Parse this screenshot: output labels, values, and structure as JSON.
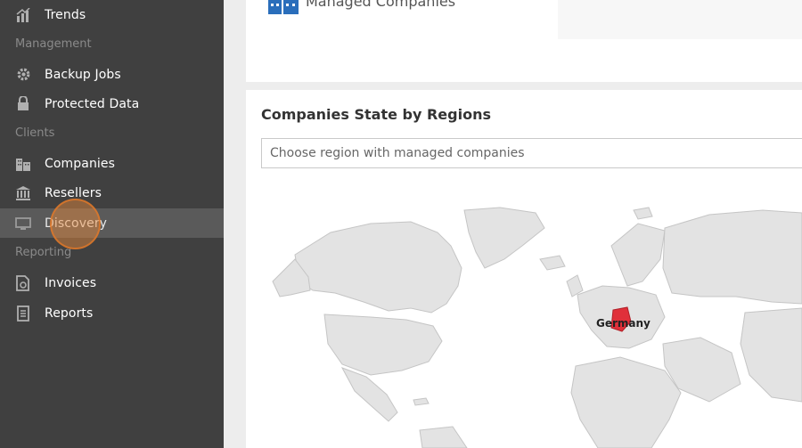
{
  "sidebar": {
    "items": [
      {
        "label": "Trends",
        "icon": "trends-icon"
      },
      {
        "label": "Backup Jobs",
        "icon": "gear-icon"
      },
      {
        "label": "Protected Data",
        "icon": "lock-icon"
      },
      {
        "label": "Companies",
        "icon": "buildings-icon"
      },
      {
        "label": "Resellers",
        "icon": "bank-icon"
      },
      {
        "label": "Discovery",
        "icon": "monitor-icon"
      },
      {
        "label": "Invoices",
        "icon": "invoice-icon"
      },
      {
        "label": "Reports",
        "icon": "report-icon"
      }
    ],
    "sections": [
      "Management",
      "Clients",
      "Reporting"
    ]
  },
  "header": {
    "title": "Managed Companies"
  },
  "map_section": {
    "title": "Companies State by Regions",
    "placeholder": "Choose region with managed companies",
    "highlighted_country": "Germany",
    "highlight_color": "#e0303a"
  },
  "colors": {
    "sidebar_bg": "#404040",
    "active_item_bg": "#5a5a5a",
    "accent": "#2a6ebb"
  }
}
